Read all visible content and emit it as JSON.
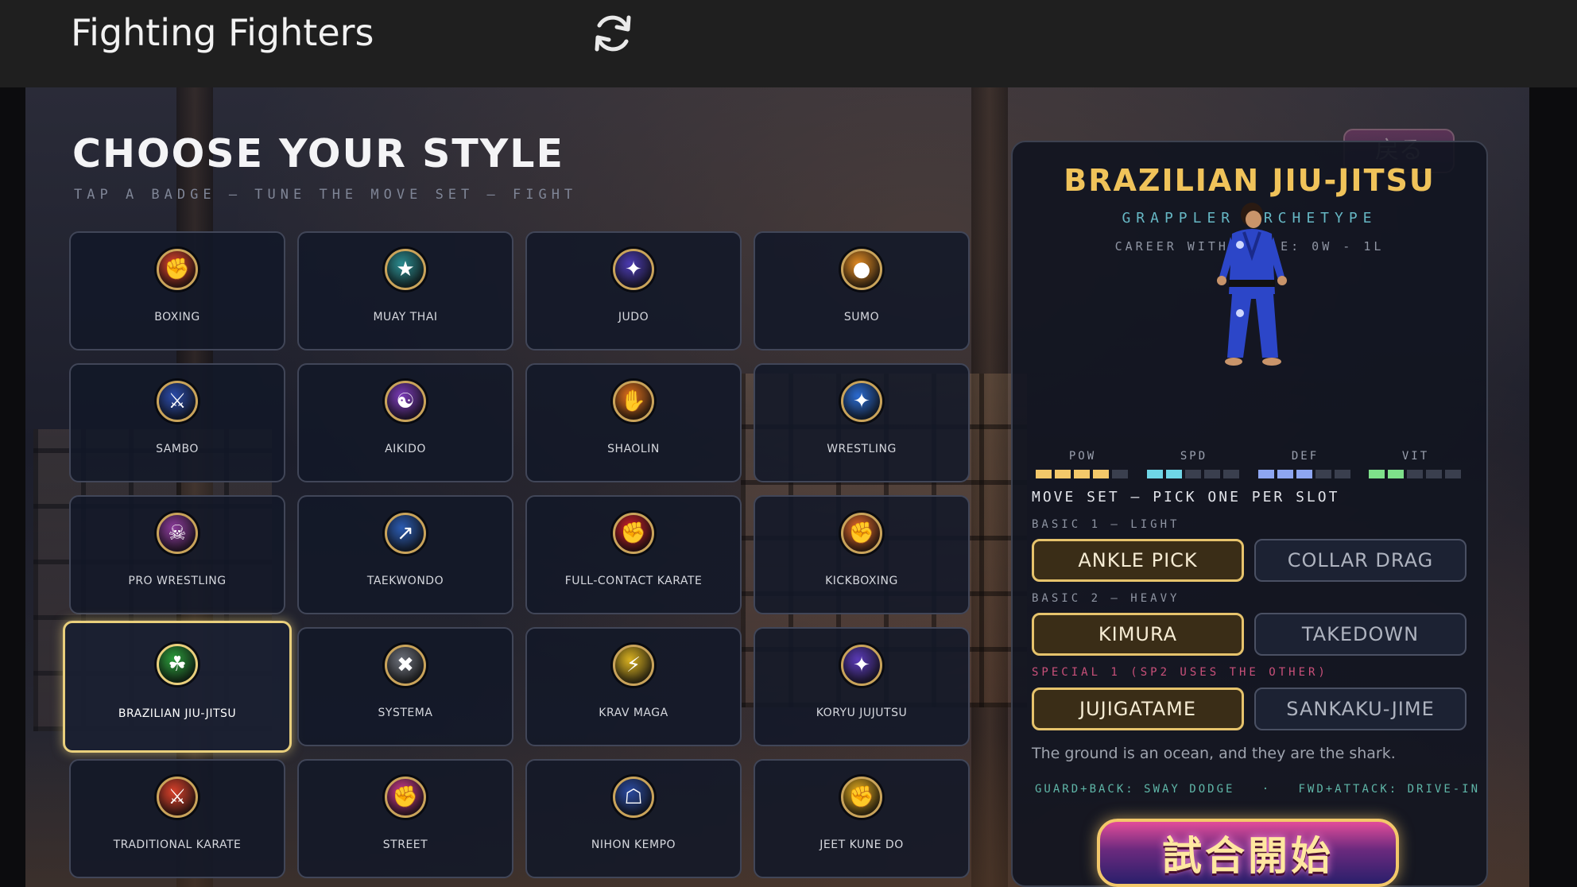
{
  "app": {
    "title": "Fighting Fighters"
  },
  "header": {
    "title": "CHOOSE YOUR STYLE",
    "subtitle": "TAP A BADGE — TUNE THE MOVE SET — FIGHT"
  },
  "styles": [
    {
      "label": "BOXING",
      "icon": "boxing-glove-icon",
      "glyph": "✊",
      "color": "#d8422c",
      "selected": false
    },
    {
      "label": "MUAY THAI",
      "icon": "muay-thai-kick-icon",
      "glyph": "★",
      "color": "#2a8a8e",
      "selected": false
    },
    {
      "label": "JUDO",
      "icon": "judo-throw-icon",
      "glyph": "✦",
      "color": "#4a3ab0",
      "selected": false
    },
    {
      "label": "SUMO",
      "icon": "sumo-belt-icon",
      "glyph": "●",
      "color": "#e08a22",
      "selected": false
    },
    {
      "label": "SAMBO",
      "icon": "sambo-grapple-icon",
      "glyph": "⚔",
      "color": "#2a4aa8",
      "selected": false
    },
    {
      "label": "AIKIDO",
      "icon": "aikido-swirl-icon",
      "glyph": "☯",
      "color": "#7a3ab8",
      "selected": false
    },
    {
      "label": "SHAOLIN",
      "icon": "shaolin-palm-icon",
      "glyph": "✋",
      "color": "#e0701c",
      "selected": false
    },
    {
      "label": "WRESTLING",
      "icon": "wrestling-grapple-icon",
      "glyph": "✦",
      "color": "#2a6ad0",
      "selected": false
    },
    {
      "label": "PRO WRESTLING",
      "icon": "luchador-mask-icon",
      "glyph": "☠",
      "color": "#8a3a9a",
      "selected": false
    },
    {
      "label": "TAEKWONDO",
      "icon": "taekwondo-kick-icon",
      "glyph": "↗",
      "color": "#2a5ab0",
      "selected": false
    },
    {
      "label": "FULL-CONTACT KARATE",
      "icon": "karate-fist-icon",
      "glyph": "✊",
      "color": "#c8202a",
      "selected": false
    },
    {
      "label": "KICKBOXING",
      "icon": "kickboxing-glove-icon",
      "glyph": "✊",
      "color": "#e0682a",
      "selected": false
    },
    {
      "label": "BRAZILIAN JIU-JITSU",
      "icon": "bjj-grapple-icon",
      "glyph": "☘",
      "color": "#2a9a3a",
      "selected": true
    },
    {
      "label": "SYSTEMA",
      "icon": "systema-cross-icon",
      "glyph": "✖",
      "color": "#6a6e78",
      "selected": false
    },
    {
      "label": "KRAV MAGA",
      "icon": "krav-maga-icon",
      "glyph": "⚡",
      "color": "#d8b020",
      "selected": false
    },
    {
      "label": "KORYU JUJUTSU",
      "icon": "koryu-jujutsu-icon",
      "glyph": "✦",
      "color": "#5a3ab8",
      "selected": false
    },
    {
      "label": "TRADITIONAL KARATE",
      "icon": "karate-chop-icon",
      "glyph": "⚔",
      "color": "#d8402a",
      "selected": false
    },
    {
      "label": "STREET",
      "icon": "street-fist-icon",
      "glyph": "✊",
      "color": "#c83a8a",
      "selected": false
    },
    {
      "label": "NIHON KEMPO",
      "icon": "kempo-armor-icon",
      "glyph": "☖",
      "color": "#2a4aa0",
      "selected": false
    },
    {
      "label": "JEET KUNE DO",
      "icon": "jkd-fist-icon",
      "glyph": "✊",
      "color": "#e0a81c",
      "selected": false
    }
  ],
  "detail": {
    "back_label": "戻る",
    "name": "BRAZILIAN JIU-JITSU",
    "archetype": "GRAPPLER ARCHETYPE",
    "career": "CAREER WITH STYLE: 0W - 1L",
    "stats": [
      {
        "label": "POW",
        "value": 4,
        "max": 5,
        "color": "#f3c86a"
      },
      {
        "label": "SPD",
        "value": 2,
        "max": 5,
        "color": "#6fd6e6"
      },
      {
        "label": "DEF",
        "value": 3,
        "max": 5,
        "color": "#8ea6f2"
      },
      {
        "label": "VIT",
        "value": 2,
        "max": 5,
        "color": "#7ee08a"
      }
    ],
    "moveset_title": "MOVE SET — PICK ONE PER SLOT",
    "slots": [
      {
        "label": "BASIC 1 — LIGHT",
        "options": [
          "ANKLE PICK",
          "COLLAR DRAG"
        ],
        "selected": 0
      },
      {
        "label": "BASIC 2 — HEAVY",
        "options": [
          "KIMURA",
          "TAKEDOWN"
        ],
        "selected": 0
      },
      {
        "label": "SPECIAL 1 (SP2 USES THE OTHER)",
        "options": [
          "JUJIGATAME",
          "SANKAKU-JIME"
        ],
        "selected": 0
      }
    ],
    "flavor": "The ground is an ocean, and they are the shark.",
    "hint_1": "GUARD+BACK: SWAY DODGE",
    "hint_sep": "·",
    "hint_2": "FWD+ATTACK: DRIVE-IN",
    "fight_label": "試合開始"
  },
  "colors": {
    "accent_gold": "#e9cf7c",
    "teal": "#66b7c4",
    "special_pink": "#c9507a"
  }
}
